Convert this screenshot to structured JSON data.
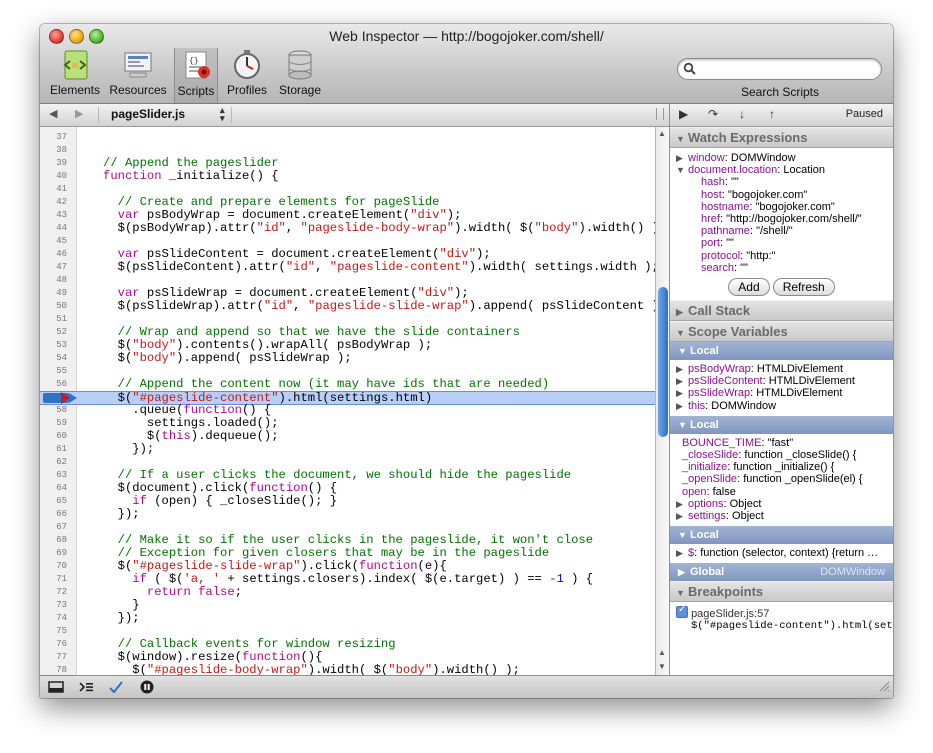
{
  "window": {
    "title": "Web Inspector — http://bogojoker.com/shell/"
  },
  "toolbar": {
    "items": [
      {
        "label": "Elements",
        "icon": "elements-icon"
      },
      {
        "label": "Resources",
        "icon": "resources-icon"
      },
      {
        "label": "Scripts",
        "icon": "scripts-icon",
        "selected": true
      },
      {
        "label": "Profiles",
        "icon": "profiles-icon"
      },
      {
        "label": "Storage",
        "icon": "storage-icon"
      }
    ],
    "search_placeholder": "",
    "search_label": "Search Scripts"
  },
  "script_nav": {
    "back": "◀",
    "forward": "▶",
    "file": "pageSlider.js",
    "select_arrows": "▴▾"
  },
  "code": {
    "exec_line": 57,
    "lines": [
      {
        "n": "37",
        "t": ""
      },
      {
        "n": "38",
        "t": ""
      },
      {
        "n": "39",
        "t": "// Append the pageslider"
      },
      {
        "n": "40",
        "t": "function _initialize() {"
      },
      {
        "n": "41",
        "t": ""
      },
      {
        "n": "42",
        "t": "  // Create and prepare elements for pageSlide"
      },
      {
        "n": "43",
        "t": "  var psBodyWrap = document.createElement(\"div\");"
      },
      {
        "n": "44",
        "t": "  $(psBodyWrap).attr(\"id\", \"pageslide-body-wrap\").width( $(\"body\").width() );"
      },
      {
        "n": "45",
        "t": ""
      },
      {
        "n": "46",
        "t": "  var psSlideContent = document.createElement(\"div\");"
      },
      {
        "n": "47",
        "t": "  $(psSlideContent).attr(\"id\", \"pageslide-content\").width( settings.width );"
      },
      {
        "n": "48",
        "t": ""
      },
      {
        "n": "49",
        "t": "  var psSlideWrap = document.createElement(\"div\");"
      },
      {
        "n": "50",
        "t": "  $(psSlideWrap).attr(\"id\", \"pageslide-slide-wrap\").append( psSlideContent );"
      },
      {
        "n": "51",
        "t": ""
      },
      {
        "n": "52",
        "t": "  // Wrap and append so that we have the slide containers"
      },
      {
        "n": "53",
        "t": "  $(\"body\").contents().wrapAll( psBodyWrap );"
      },
      {
        "n": "54",
        "t": "  $(\"body\").append( psSlideWrap );"
      },
      {
        "n": "55",
        "t": ""
      },
      {
        "n": "56",
        "t": "  // Append the content now (it may have ids that are needed)"
      },
      {
        "n": "57",
        "t": "  $(\"#pageslide-content\").html(settings.html)"
      },
      {
        "n": "58",
        "t": "    .queue(function() {"
      },
      {
        "n": "59",
        "t": "      settings.loaded();"
      },
      {
        "n": "60",
        "t": "      $(this).dequeue();"
      },
      {
        "n": "61",
        "t": "    });"
      },
      {
        "n": "62",
        "t": ""
      },
      {
        "n": "63",
        "t": "  // If a user clicks the document, we should hide the pageslide"
      },
      {
        "n": "64",
        "t": "  $(document).click(function() {"
      },
      {
        "n": "65",
        "t": "    if (open) { _closeSlide(); }"
      },
      {
        "n": "66",
        "t": "  });"
      },
      {
        "n": "67",
        "t": ""
      },
      {
        "n": "68",
        "t": "  // Make it so if the user clicks in the pageslide, it won't close"
      },
      {
        "n": "69",
        "t": "  // Exception for given closers that may be in the pageslide"
      },
      {
        "n": "70",
        "t": "  $(\"#pageslide-slide-wrap\").click(function(e){"
      },
      {
        "n": "71",
        "t": "    if ( $('a, ' + settings.closers).index( $(e.target) ) == -1 ) {"
      },
      {
        "n": "72",
        "t": "      return false;"
      },
      {
        "n": "73",
        "t": "    }"
      },
      {
        "n": "74",
        "t": "  });"
      },
      {
        "n": "75",
        "t": ""
      },
      {
        "n": "76",
        "t": "  // Callback events for window resizing"
      },
      {
        "n": "77",
        "t": "  $(window).resize(function(){"
      },
      {
        "n": "78",
        "t": "    $(\"#pageslide-body-wrap\").width( $(\"body\").width() );"
      }
    ]
  },
  "debugger": {
    "status": "Paused",
    "sections": {
      "watch": "Watch Expressions",
      "callstack": "Call Stack",
      "scope": "Scope Variables",
      "breakpoints": "Breakpoints"
    },
    "watch_items": [
      {
        "tri": "▶",
        "name": "window",
        "value": "DOMWindow",
        "indent": 0
      },
      {
        "tri": "▼",
        "name": "document.location",
        "value": "Location",
        "indent": 0
      },
      {
        "tri": "",
        "name": "hash",
        "value": "\"\"",
        "indent": 1
      },
      {
        "tri": "",
        "name": "host",
        "value": "\"bogojoker.com\"",
        "indent": 1
      },
      {
        "tri": "",
        "name": "hostname",
        "value": "\"bogojoker.com\"",
        "indent": 1
      },
      {
        "tri": "",
        "name": "href",
        "value": "\"http://bogojoker.com/shell/\"",
        "indent": 1
      },
      {
        "tri": "",
        "name": "pathname",
        "value": "\"/shell/\"",
        "indent": 1
      },
      {
        "tri": "",
        "name": "port",
        "value": "\"\"",
        "indent": 1
      },
      {
        "tri": "",
        "name": "protocol",
        "value": "\"http:\"",
        "indent": 1
      },
      {
        "tri": "",
        "name": "search",
        "value": "\"\"",
        "indent": 1
      }
    ],
    "add_label": "Add",
    "refresh_label": "Refresh",
    "scopes": [
      {
        "title": "Local",
        "right": "",
        "items": [
          {
            "tri": "▶",
            "name": "psBodyWrap",
            "value": "HTMLDivElement"
          },
          {
            "tri": "▶",
            "name": "psSlideContent",
            "value": "HTMLDivElement"
          },
          {
            "tri": "▶",
            "name": "psSlideWrap",
            "value": "HTMLDivElement"
          },
          {
            "tri": "▶",
            "name": "this",
            "value": "DOMWindow"
          }
        ]
      },
      {
        "title": "Local",
        "right": "",
        "items": [
          {
            "tri": "",
            "name": "BOUNCE_TIME",
            "value": "\"fast\""
          },
          {
            "tri": "",
            "name": "_closeSlide",
            "value": "function _closeSlide() {"
          },
          {
            "tri": "",
            "name": "_initialize",
            "value": "function _initialize() {"
          },
          {
            "tri": "",
            "name": "_openSlide",
            "value": "function _openSlide(el) {"
          },
          {
            "tri": "",
            "name": "open",
            "value": "false"
          },
          {
            "tri": "▶",
            "name": "options",
            "value": "Object"
          },
          {
            "tri": "▶",
            "name": "settings",
            "value": "Object"
          }
        ]
      },
      {
        "title": "Local",
        "right": "",
        "items": [
          {
            "tri": "▶",
            "name": "$",
            "value": "function (selector, context) {return …"
          }
        ]
      },
      {
        "title": "Global",
        "right": "DOMWindow",
        "items": []
      }
    ],
    "breakpoint": {
      "location": "pageSlider.js:57",
      "code": "$(\"#pageslide-content\").html(set…",
      "checked": true
    }
  },
  "colors": {
    "accent": "#2f72c6",
    "exec_highlight": "#b7cff5",
    "keyword": "#aa0d91",
    "string": "#c41a16",
    "comment": "#007400",
    "number": "#1c00cf"
  }
}
